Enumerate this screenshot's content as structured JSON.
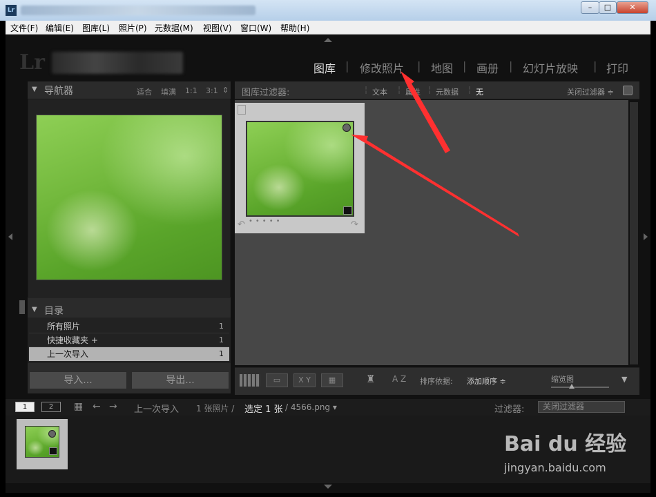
{
  "menubar": {
    "items": [
      "文件(F)",
      "编辑(E)",
      "图库(L)",
      "照片(P)",
      "元数据(M)",
      "视图(V)",
      "窗口(W)",
      "帮助(H)"
    ]
  },
  "app_icon": "Lr",
  "window_buttons": {
    "minimize": "–",
    "maximize": "□",
    "close": "✕"
  },
  "identity_logo": "Lr",
  "modules": [
    "图库",
    "修改照片",
    "地图",
    "画册",
    "幻灯片放映",
    "打印"
  ],
  "navigator": {
    "title": "导航器",
    "options": [
      "适合",
      "填满",
      "1:1",
      "3:1"
    ],
    "expand_icon": "▼"
  },
  "catalog": {
    "title": "目录",
    "items": [
      {
        "label": "所有照片",
        "count": "1"
      },
      {
        "label": "快捷收藏夹 +",
        "count": "1"
      },
      {
        "label": "上一次导入",
        "count": "1"
      }
    ]
  },
  "buttons": {
    "import": "导入...",
    "export": "导出..."
  },
  "filter_bar": {
    "title": "图库过滤器:",
    "options": [
      "文本",
      "属性",
      "元数据",
      "无"
    ],
    "close_filter": "关闭过滤器 ≑"
  },
  "toolbar": {
    "sort_label": "排序依据:",
    "sort_value": "添加顺序 ≑",
    "thumb_label": "缩览图",
    "az_label": "A Z",
    "xy_label": "X Y"
  },
  "filmstrip_bar": {
    "page1": "1",
    "page2": "2",
    "source": "上一次导入",
    "count_text": "1 张照片 /",
    "selected_text": "选定 1 张",
    "filename": "/ 4566.png ▾",
    "filter_label": "过滤器:",
    "filter_value": "关闭过滤器"
  },
  "watermark": {
    "brand": "Bai du 经验",
    "url": "jingyan.baidu.com"
  },
  "colors": {
    "accent_arrow": "#ff3030"
  }
}
